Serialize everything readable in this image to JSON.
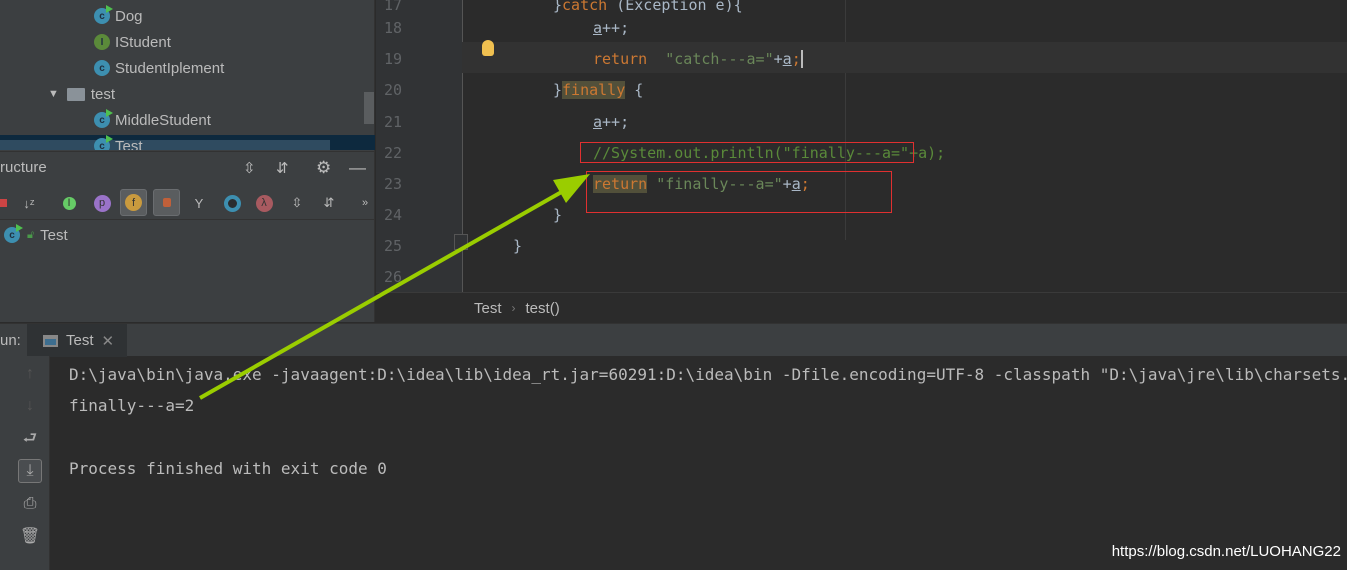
{
  "project_tree": {
    "items": [
      {
        "label": "Dog",
        "icon": "class-runnable-icon"
      },
      {
        "label": "IStudent",
        "icon": "interface-icon"
      },
      {
        "label": "StudentIplement",
        "icon": "class-icon"
      },
      {
        "label": "test",
        "icon": "folder-icon"
      },
      {
        "label": "MiddleStudent",
        "icon": "class-runnable-icon"
      },
      {
        "label": "Test",
        "icon": "class-runnable-icon",
        "selected": true
      }
    ]
  },
  "structure": {
    "title": "ructure",
    "item": "Test"
  },
  "editor": {
    "line_numbers": [
      "17",
      "18",
      "19",
      "20",
      "21",
      "22",
      "23",
      "24",
      "25",
      "26"
    ],
    "lines": [
      "}catch (Exception e){",
      "a++;",
      "return  \"catch---a=\"+a;",
      "}finally {",
      "a++;",
      "//System.out.println(\"finally---a=\"+a);",
      "return \"finally---a=\"+a;",
      "}",
      "}",
      ""
    ],
    "tokens": {
      "catch": "catch",
      "exception": " (Exception e){",
      "a": "a",
      "pp": "++;",
      "return": "return",
      "catch_str": "\"catch---a=\"",
      "plus": "+",
      "semi": ";",
      "close": "}",
      "finally": "finally",
      "open": " {",
      "comment": "//System.out.println(\"finally---a=\"+a);",
      "finally_str": "\"finally---a=\""
    }
  },
  "breadcrumb": {
    "items": [
      "Test",
      "test()"
    ]
  },
  "run": {
    "label": "un:",
    "tab": "Test",
    "console": [
      "D:\\java\\bin\\java.exe -javaagent:D:\\idea\\lib\\idea_rt.jar=60291:D:\\idea\\bin -Dfile.encoding=UTF-8 -classpath \"D:\\java\\jre\\lib\\charsets.jar",
      "finally---a=2",
      "",
      "Process finished with exit code 0"
    ]
  },
  "watermark": "https://blog.csdn.net/LUOHANG22",
  "colors": {
    "arrow": "#9acd00",
    "highlight_box": "#e03030",
    "keyword": "#cc7832",
    "string": "#6a8759"
  }
}
